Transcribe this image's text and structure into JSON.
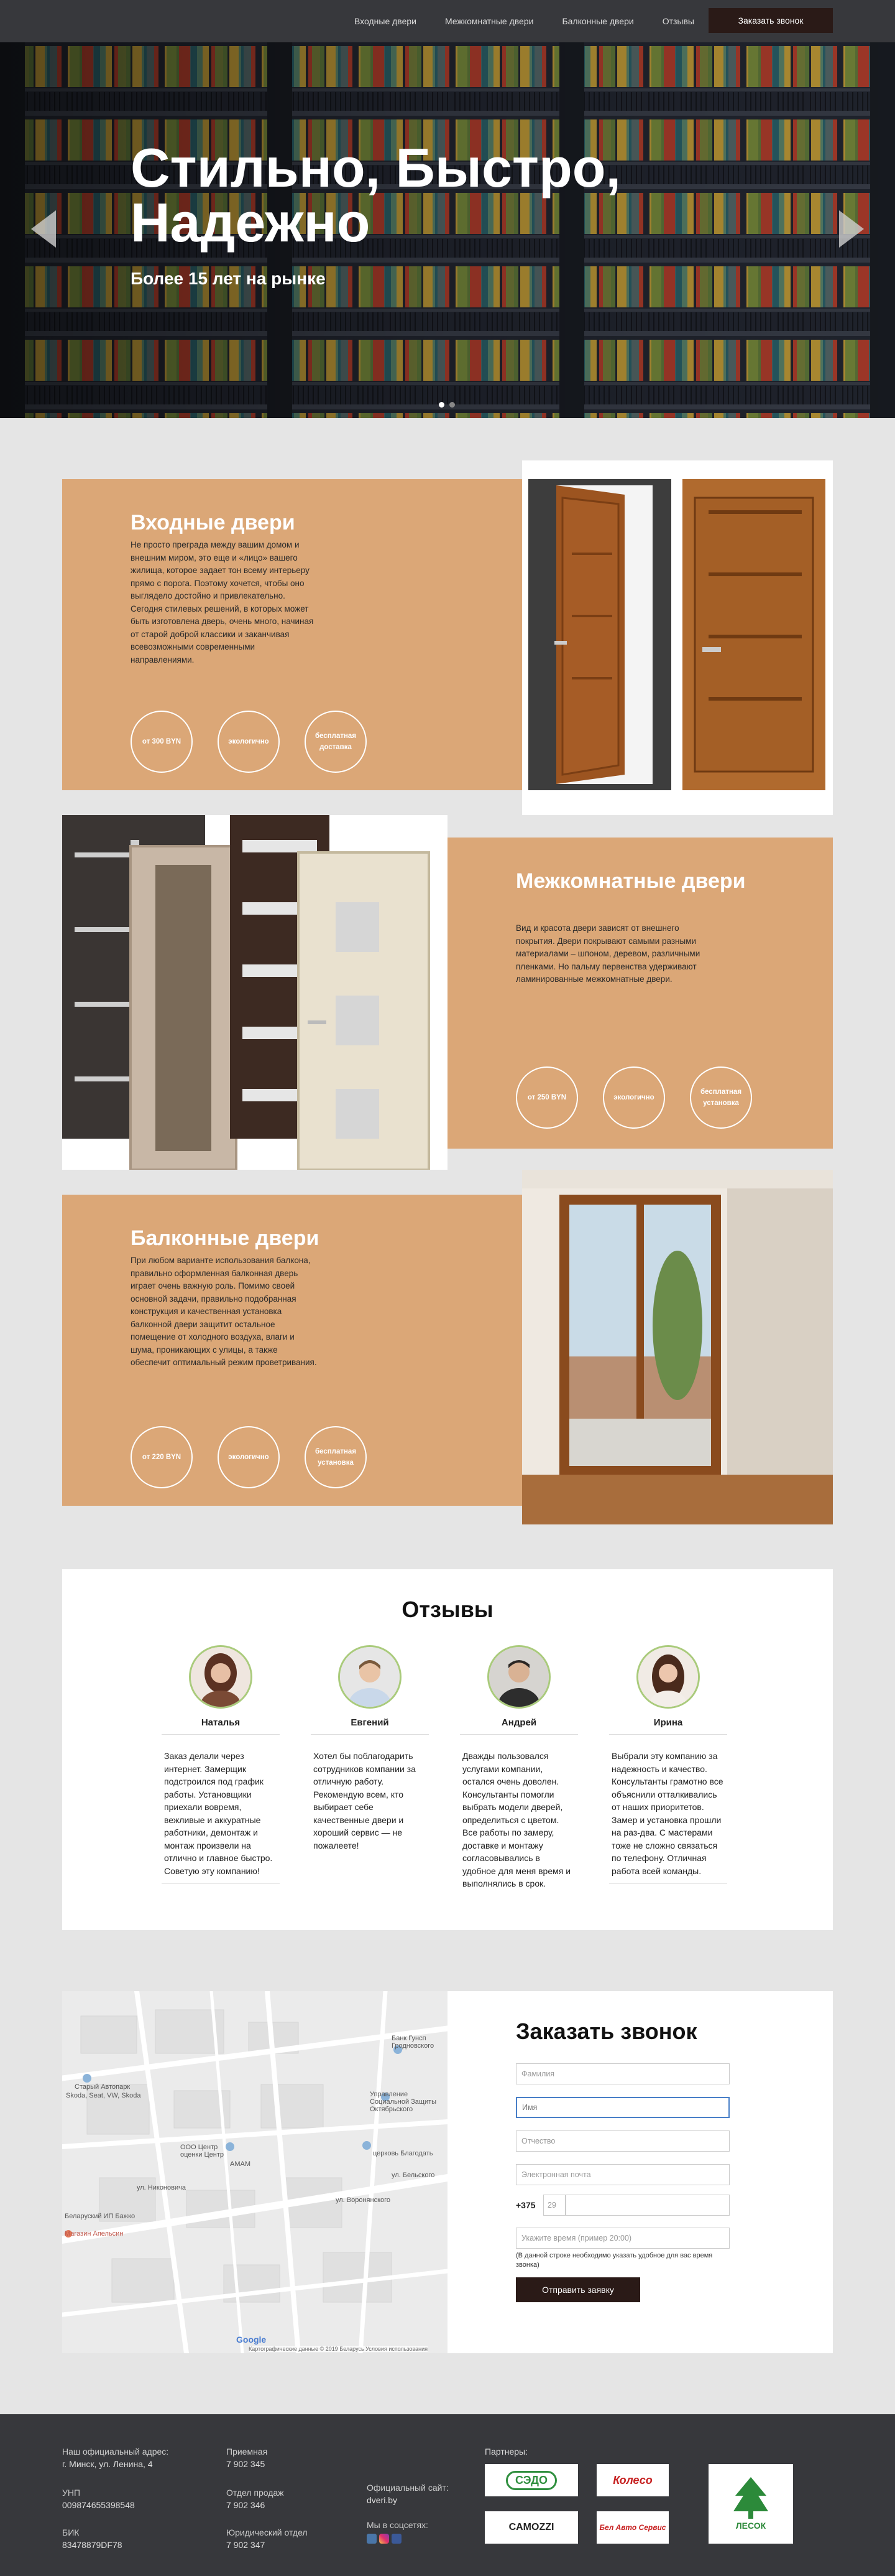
{
  "nav": {
    "items": [
      "Входные двери",
      "Межкомнатные двери",
      "Балконные двери",
      "Отзывы"
    ],
    "call_button": "Заказать звонок"
  },
  "hero": {
    "title": "Стильно, Быстро, Надежно",
    "subtitle": "Более 15 лет на рынке"
  },
  "sections": [
    {
      "title": "Входные двери",
      "text": "Не просто преграда между вашим домом и внешним миром, это еще и «лицо» вашего жилища, которое задает тон всему интерьеру прямо с порога. Поэтому хочется, чтобы оно выглядело достойно и привлекательно. Сегодня стилевых решений, в которых может быть изготовлена дверь, очень много, начиная от старой доброй классики и заканчивая всевозможными современными направлениями.",
      "badges": [
        "от 300 BYN",
        "экологично",
        "бесплатная доставка"
      ]
    },
    {
      "title": "Межкомнатные двери",
      "text": "Вид и красота двери зависят от внешнего покрытия. Двери покрывают самыми разными материалами – шпоном, деревом, различными пленками. Но пальму первенства удерживают ламинированные межкомнатные двери.",
      "badges": [
        "от 250 BYN",
        "экологично",
        "бесплатная установка"
      ]
    },
    {
      "title": "Балконные двери",
      "text": "При любом варианте использования балкона, правильно оформленная балконная дверь играет очень важную роль. Помимо своей основной задачи, правильно подобранная конструкция и качественная установка балконной двери защитит остальное помещение от холодного воздуха, влаги и шума, проникающих с улицы, а также обеспечит оптимальный режим проветривания.",
      "badges": [
        "от 220 BYN",
        "экологично",
        "бесплатная установка"
      ]
    }
  ],
  "reviews": {
    "title": "Отзывы",
    "items": [
      {
        "name": "Наталья",
        "text": "Заказ делали через интернет. Замерщик подстроился под график работы. Установщики приехали вовремя, вежливые и аккуратные работники, демонтаж и монтаж произвели на отлично и главное быстро. Советую эту компанию!"
      },
      {
        "name": "Евгений",
        "text": "Хотел бы поблагодарить сотрудников компании за отличную работу. Рекомендую всем, кто выбирает себе качественные двери и хороший сервис — не пожалеете!"
      },
      {
        "name": "Андрей",
        "text": "Дважды пользовался услугами компании, остался очень доволен. Консультанты помогли выбрать модели дверей, определиться с цветом. Все работы по замеру, доставке и монтажу согласовывались в удобное для меня время и выполнялись в срок."
      },
      {
        "name": "Ирина",
        "text": "Выбрали эту компанию за надежность и качество. Консультанты грамотно все объяснили отталкивались от наших приоритетов. Замер и установка прошли на раз-два. С мастерами тоже не сложно связаться по телефону. Отличная работа всей команды."
      }
    ]
  },
  "map": {
    "labels": [
      "Банк Гунсп Гродновского",
      "Управление Социальной Защиты Октябрьского",
      "ООО Центр оценки Центр",
      "церковь Благодать",
      "Старый Автопарк",
      "Skoda, Seat, VW, Skoda",
      "ул. Никоновича",
      "АМАМ",
      "Беларуский ИП Бажко",
      "Магазин Апельсин",
      "ул. Воронянского",
      "ул. Бельского"
    ],
    "google": "Google",
    "attribution": "Картографические данные © 2019   Беларусь   Условия использования"
  },
  "callback": {
    "title": "Заказать звонок",
    "placeholders": {
      "surname": "Фамилия",
      "name": "Имя",
      "patronymic": "Отчество",
      "email": "Электронная почта",
      "code": "29",
      "time": "Укажите время (пример 20:00)"
    },
    "phone_prefix": "+375",
    "note": "(В данной строке необходимо указать удобное для вас время звонка)",
    "submit": "Отправить заявку"
  },
  "footer": {
    "address_label": "Наш официальный адрес:",
    "address": "г. Минск, ул. Ленина, 4",
    "unp_label": "УНП",
    "unp": "009874655398548",
    "bik_label": "БИК",
    "bik": "83478879DF78",
    "reception_label": "Приемная",
    "reception": "7 902 345",
    "sales_label": "Отдел продаж",
    "sales": "7 902 346",
    "legal_label": "Юридический отдел",
    "legal": "7 902 347",
    "site_label": "Официальный сайт:",
    "site": "dveri.by",
    "social_label": "Мы в соцсетях:",
    "partners_label": "Партнеры:",
    "partners": [
      "СЭДО",
      "Колесо",
      "ЛЕСОК",
      "CAMOZZI",
      "Бел Авто Сервис"
    ]
  },
  "colors": {
    "accent": "#dba777",
    "dark": "#37383c",
    "button": "#2a1a17"
  }
}
